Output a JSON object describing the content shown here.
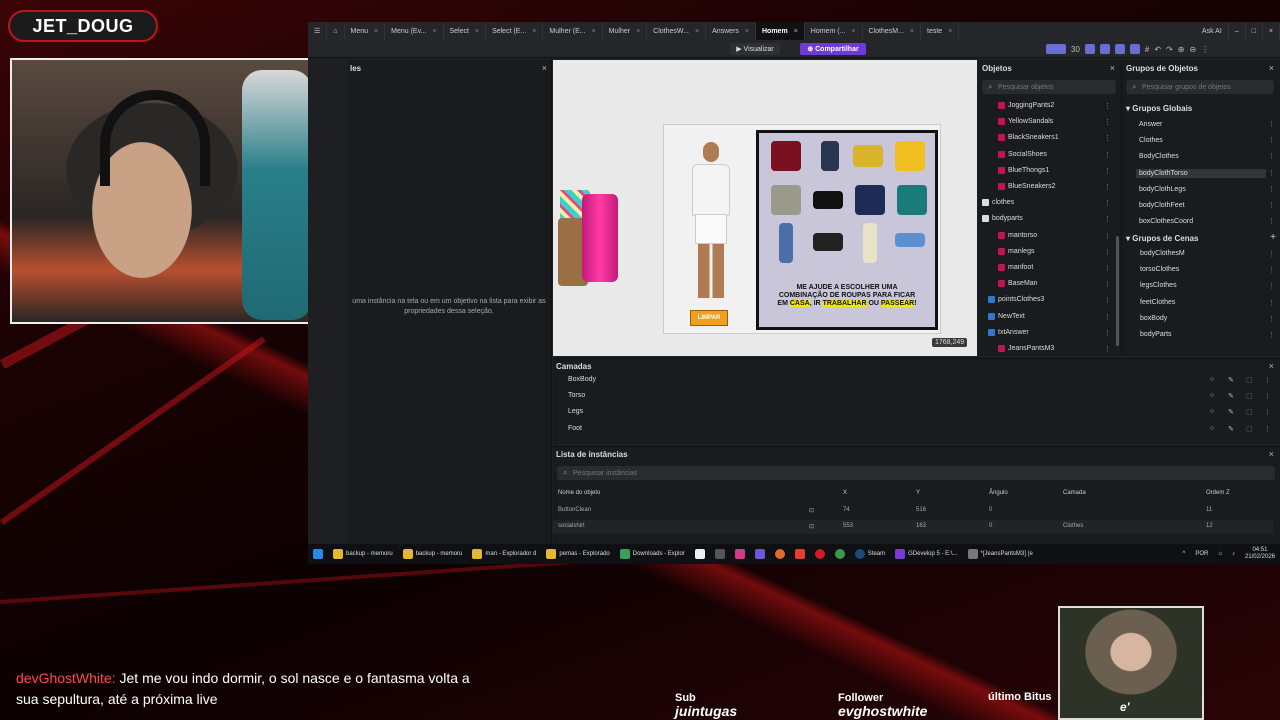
{
  "overlay": {
    "streamer_name": "JET_DOUG",
    "chat_user": "devGhostWhite:",
    "chat_message": "Jet me vou indo dormir, o sol nasce e o fantasma volta a sua sepultura, até a próxima live",
    "sub_label": "Sub",
    "sub_name": "juintugas",
    "follower_label": "Follower",
    "follower_name": "evghostwhite",
    "bits_label": "último Bitus",
    "bits_value": "e'"
  },
  "tabs": [
    {
      "label": "Menu"
    },
    {
      "label": "Menu (Ev..."
    },
    {
      "label": "Select"
    },
    {
      "label": "Select (E..."
    },
    {
      "label": "Mulher (E..."
    },
    {
      "label": "Mulher"
    },
    {
      "label": "ClothesW..."
    },
    {
      "label": "Answers"
    },
    {
      "label": "Homem",
      "active": true
    },
    {
      "label": "Homem (..."
    },
    {
      "label": "ClothesM..."
    },
    {
      "label": "teste"
    }
  ],
  "window_user": "Ask AI",
  "toolbar": {
    "view_label": "Visualizar",
    "share_label": "Compartilhar"
  },
  "left_panel": {
    "title": "les",
    "hint": "uma instância na tela ou em um objetivo na lista para exibir as propriedades dessa seleção."
  },
  "scene": {
    "coords": "1768,249",
    "wardrobe_text_1": "ME AJUDE A ESCOLHER UMA",
    "wardrobe_text_2": "COMBINAÇÃO DE ROUPAS PARA FICAR",
    "wardrobe_text_3a": "EM ",
    "wardrobe_hl_1": "CASA",
    "wardrobe_text_3b": ", IR ",
    "wardrobe_hl_2": "TRABALHAR",
    "wardrobe_text_3c": " OU ",
    "wardrobe_hl_3": "PASSEAR",
    "wardrobe_text_3d": "!",
    "clear_button": "LIMPAR"
  },
  "objects_panel": {
    "title": "Objetos",
    "search_placeholder": "Pesquisar objetos",
    "items": [
      "JoggingPants2",
      "YellowSandals",
      "BlackSneakers1",
      "SocialShoes",
      "BlueThongs1",
      "BlueSneakers2",
      "clothes",
      "bodyparts",
      "mantorso",
      "manlegs",
      "manfoot",
      "BaseMan",
      "pointsClothes3",
      "NewText",
      "txtAnswer",
      "JeansPantsM3"
    ]
  },
  "groups_panel": {
    "title": "Grupos de Objetos",
    "search_placeholder": "Pesquisar grupos de objetos",
    "global_title": "Grupos Globais",
    "global_items": [
      "Answer",
      "Clothes",
      "BodyClothes",
      "bodyClothTorso",
      "bodyClothLegs",
      "bodyClothFeet",
      "boxClothesCoord"
    ],
    "scene_title": "Grupos de Cenas",
    "scene_items": [
      "bodyClothesM",
      "torsoClothes",
      "legsClothes",
      "feetClothes",
      "boxBody",
      "bodyParts"
    ]
  },
  "layers": {
    "title": "Camadas",
    "items": [
      "BoxBody",
      "Torso",
      "Legs",
      "Foot"
    ]
  },
  "instances": {
    "title": "Lista de instâncias",
    "search_placeholder": "Pesquisar instâncias",
    "columns": [
      "Nome do objeto",
      "X",
      "Y",
      "Ângulo",
      "Camada",
      "Ordem Z"
    ],
    "rows": [
      {
        "name": "ButtonClean",
        "x": "74",
        "y": "516",
        "angle": "0",
        "layer": "",
        "z": "11"
      },
      {
        "name": "socialshirt",
        "x": "553",
        "y": "163",
        "angle": "0",
        "layer": "Clothes",
        "z": "12"
      }
    ]
  },
  "taskbar": {
    "items": [
      "backup - memoru",
      "backup - memoru",
      "man - Explorador d",
      "pemas - Explorado",
      "Downloads - Explor",
      "Steam",
      "GDevelop 5 - E:\\...",
      "*[JeansPantsM3] (e"
    ],
    "lang": "POR",
    "time": "04:51",
    "date": "21/02/2026"
  },
  "colors": {
    "accent": "#6f3ad6",
    "brand": "#c0141a",
    "highlight": "#f2e600"
  }
}
